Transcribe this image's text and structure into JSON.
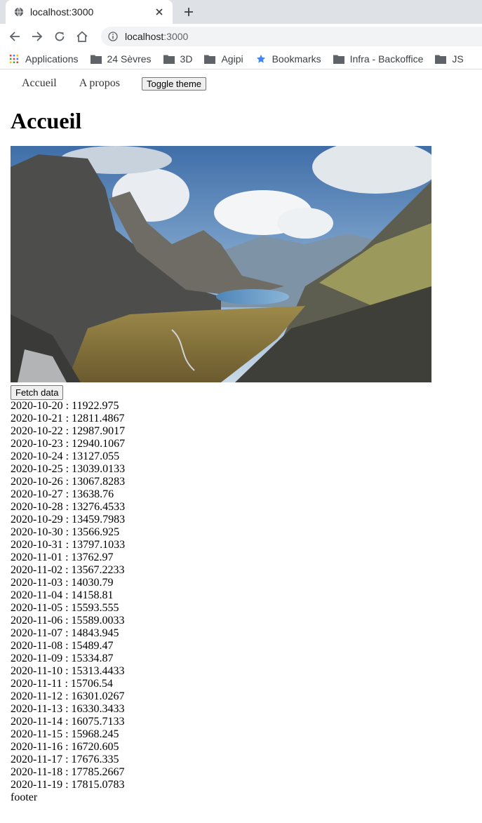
{
  "browser": {
    "tab_title": "localhost:3000",
    "url_host": "localhost",
    "url_port": ":3000",
    "bookmarks": [
      {
        "label": "Applications",
        "icon": "apps-grid-icon"
      },
      {
        "label": "24 Sèvres",
        "icon": "folder-icon"
      },
      {
        "label": "3D",
        "icon": "folder-icon"
      },
      {
        "label": "Agipi",
        "icon": "folder-icon"
      },
      {
        "label": "Bookmarks",
        "icon": "star-icon"
      },
      {
        "label": "Infra - Backoffice",
        "icon": "folder-icon"
      },
      {
        "label": "JS",
        "icon": "folder-icon"
      }
    ]
  },
  "nav": {
    "home_label": "Accueil",
    "about_label": "A propos",
    "theme_button_label": "Toggle theme"
  },
  "page": {
    "title": "Accueil",
    "fetch_button_label": "Fetch data",
    "rows": [
      "2020-10-20 : 11922.975",
      "2020-10-21 : 12811.4867",
      "2020-10-22 : 12987.9017",
      "2020-10-23 : 12940.1067",
      "2020-10-24 : 13127.055",
      "2020-10-25 : 13039.0133",
      "2020-10-26 : 13067.8283",
      "2020-10-27 : 13638.76",
      "2020-10-28 : 13276.4533",
      "2020-10-29 : 13459.7983",
      "2020-10-30 : 13566.925",
      "2020-10-31 : 13797.1033",
      "2020-11-01 : 13762.97",
      "2020-11-02 : 13567.2233",
      "2020-11-03 : 14030.79",
      "2020-11-04 : 14158.81",
      "2020-11-05 : 15593.555",
      "2020-11-06 : 15589.0033",
      "2020-11-07 : 14843.945",
      "2020-11-08 : 15489.47",
      "2020-11-09 : 15334.87",
      "2020-11-10 : 15313.4433",
      "2020-11-11 : 15706.54",
      "2020-11-12 : 16301.0267",
      "2020-11-13 : 16330.3433",
      "2020-11-14 : 16075.7133",
      "2020-11-15 : 15968.245",
      "2020-11-16 : 16720.605",
      "2020-11-17 : 17676.335",
      "2020-11-18 : 17785.2667",
      "2020-11-19 : 17815.0783"
    ],
    "footer": "footer"
  }
}
